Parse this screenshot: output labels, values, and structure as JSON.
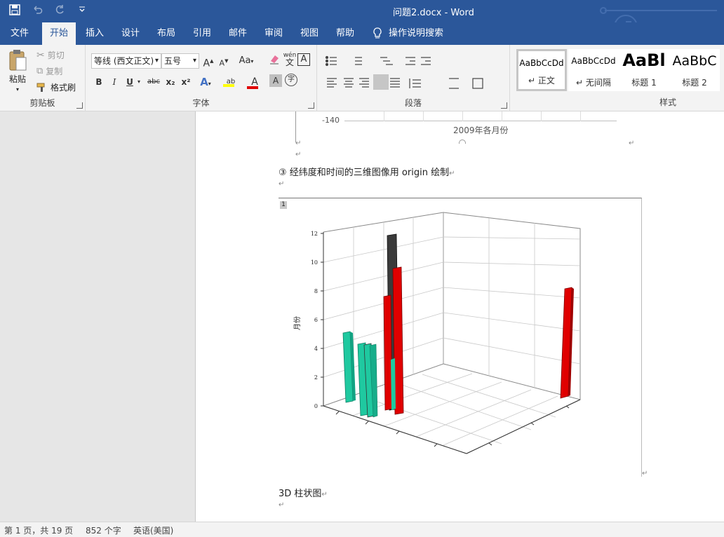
{
  "window": {
    "title": "问题2.docx  -  Word"
  },
  "qat": {
    "save_icon": "save-icon",
    "undo_icon": "undo-icon",
    "redo_icon": "redo-icon",
    "customize_icon": "chevron-down-icon"
  },
  "tabs": [
    {
      "label": "文件"
    },
    {
      "label": "开始"
    },
    {
      "label": "插入"
    },
    {
      "label": "设计"
    },
    {
      "label": "布局"
    },
    {
      "label": "引用"
    },
    {
      "label": "邮件"
    },
    {
      "label": "审阅"
    },
    {
      "label": "视图"
    },
    {
      "label": "帮助"
    }
  ],
  "tell_me": "操作说明搜索",
  "clipboard": {
    "paste": "粘贴",
    "cut": "剪切",
    "copy": "复制",
    "format_painter": "格式刷",
    "label": "剪贴板"
  },
  "font": {
    "name": "等线 (西文正文)",
    "size": "五号",
    "label": "字体",
    "bold": "B",
    "italic": "I",
    "underline": "U",
    "strike": "abc",
    "sub": "x₂",
    "sup": "x²",
    "change_case": "Aa",
    "grow": "A",
    "shrink": "A",
    "phonetic": "wén",
    "phonetic_char": "文",
    "border_char": "A",
    "text_highlight": "ab",
    "font_color": "A",
    "shading": "A",
    "enclose": "字"
  },
  "paragraph": {
    "label": "段落"
  },
  "styles": {
    "label": "样式",
    "items": [
      {
        "preview": "AaBbCcDd",
        "name": "正文"
      },
      {
        "preview": "AaBbCcDd",
        "name": "无间隔"
      },
      {
        "preview": "AaBl",
        "name": "标题 1"
      },
      {
        "preview": "AaBbC",
        "name": "标题 2"
      }
    ]
  },
  "document": {
    "prev_chart_tick": "-140",
    "prev_chart_xlabel": "2009年各月份",
    "item3": "③  经纬度和时间的三维图像用 origin 绘制",
    "figure_num": "1",
    "caption": "3D 柱状图",
    "chart_ylabel": "月份"
  },
  "chart_data": {
    "type": "bar",
    "title": "",
    "ylabel": "月份",
    "yticks": [
      "0",
      "2",
      "4",
      "6",
      "8",
      "10",
      "12"
    ],
    "ylim": [
      0,
      12
    ],
    "series": [
      {
        "color": "#1fc9a0",
        "values": [
          5,
          4,
          4
        ]
      },
      {
        "color": "#e00000",
        "values": [
          12,
          10,
          8,
          8
        ]
      }
    ]
  },
  "status": {
    "page": "第 1 页，共 19 页",
    "words": "852 个字",
    "lang": "英语(美国)"
  }
}
